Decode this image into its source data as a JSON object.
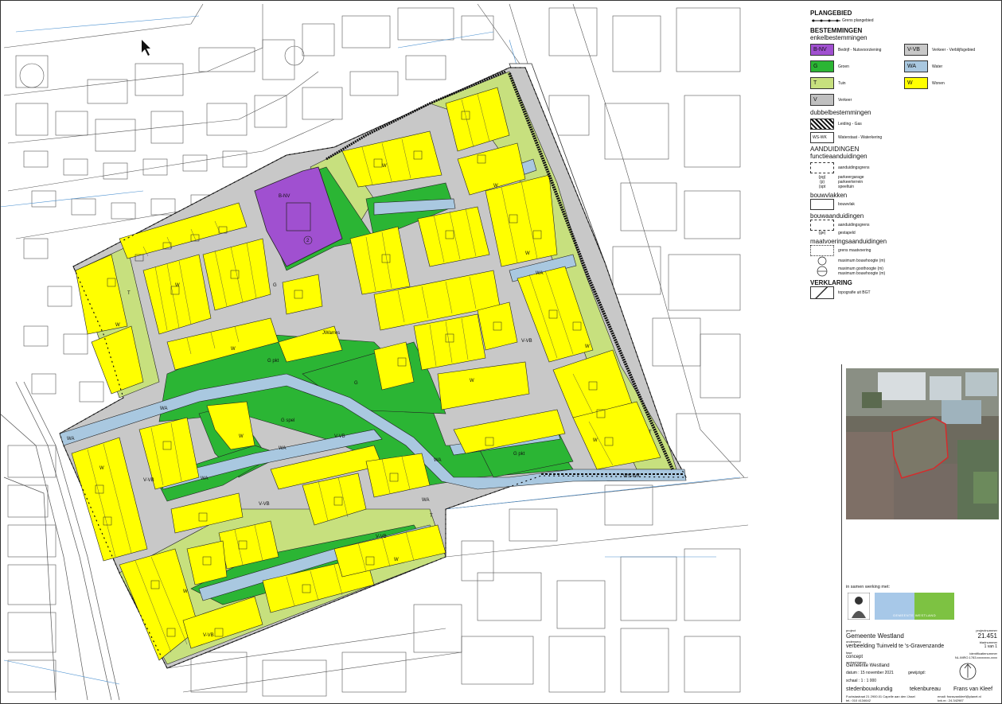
{
  "map": {
    "zone_labels": {
      "wonen": "W",
      "tuin": "T",
      "groen": "G",
      "water": "WA",
      "verkeer_verblijf": "V-VB",
      "nutsvoorziening": "B-NV",
      "water_waterkering": "WS-WK"
    },
    "annotation_labels": {
      "groen_speel": "G spel",
      "groen_park": "G pkt",
      "wonen_special": "W",
      "garage": "(pg)",
      "height_mark": "2",
      "jwarres": "JWarres"
    }
  },
  "legend": {
    "plangebied": {
      "heading": "PLANGEBIED",
      "grens": "Grens plangebied"
    },
    "bestemmingen": {
      "heading": "BESTEMMINGEN",
      "subheading": "enkelbestemmingen",
      "items": [
        {
          "code": "B-NV",
          "label": "Bedrijf - Nutsvoorziening",
          "color": "#a050d0"
        },
        {
          "code": "V-VB",
          "label": "Verkeer - Verblijfsgebied",
          "color": "#c8c8c8"
        },
        {
          "code": "G",
          "label": "Groen",
          "color": "#2bb534"
        },
        {
          "code": "WA",
          "label": "Water",
          "color": "#a9c8e0"
        },
        {
          "code": "T",
          "label": "Tuin",
          "color": "#c7e07e"
        },
        {
          "code": "W",
          "label": "Wonen",
          "color": "#ffff00"
        },
        {
          "code": "V",
          "label": "Verkeer",
          "color": "#c0c0c0"
        }
      ]
    },
    "dubbelbestemmingen": {
      "heading": "dubbelbestemmingen",
      "items": [
        {
          "code": "",
          "label": "Leiding - Gas"
        },
        {
          "code": "WS-WK",
          "label": "Waterstaat - Waterkering"
        }
      ]
    },
    "aanduidingen": {
      "heading": "AANDUIDINGEN",
      "subheading": "functieaanduidingen",
      "grens": "aanduidingsgrens",
      "codes": "(pg)\n(p)\n(spt",
      "labels": "parkeergarage\nparkeerterrein\nspeeltuin"
    },
    "bouwvlakken": {
      "heading": "bouwvlakken",
      "label": "bouwvlak"
    },
    "bouwaanduidingen": {
      "heading": "bouwaanduidingen",
      "grens": "aanduidingsgrens",
      "code": "(ge)",
      "label": "gestapeld"
    },
    "maatvoering": {
      "heading": "maatvoeringsaanduidingen",
      "grens": "grens maatvoering",
      "bouwhoogte": "maximum bouwhoogte (m)",
      "goothoogte": "maximum goothoogte (m)\nmaximum bouwhoogte (m)"
    },
    "verklaring": {
      "heading": "VERKLARING",
      "label": "topografie uit BGT"
    }
  },
  "titleblock": {
    "made_by": "in samen werking met:",
    "logo_text": "GEMEENTE WESTLAND",
    "project_label": "project",
    "project": "Gemeente Westland",
    "onderwerp_label": "onderwerp",
    "onderwerp": "verbeelding Tuinveld te 's-Gravenzande",
    "fase_label": "fase",
    "fase": "concept",
    "opdrachtgever_label": "opdrachtgever",
    "opdrachtgever": "Gemeente Westland",
    "datum": "datum : 15 november 2021",
    "gewijzigd": "gewijzigd:",
    "schaal": "schaal : 1 : 1 000",
    "projectnummer_label": "projectnummer",
    "projectnummer": "21.451",
    "bladnummer_label": "bladnummer",
    "bladnummer": "1 van 1",
    "identificatie_label": "identificatienummer",
    "identificatie": "NL.IMRO.1783.xxxxxxxx-xxxx",
    "firm1": "stedenbouwkundig",
    "firm2": "tekenbureau",
    "firm3": "Frans van Kleef",
    "address1": "Fuchsiastraat 21    2900.01 Capelle aan den IJssel",
    "address2": "tel.: 010 4134642",
    "email": "email: fransvankleef@planet.nl",
    "kvk": "kvk.nr.: 24.342987"
  }
}
